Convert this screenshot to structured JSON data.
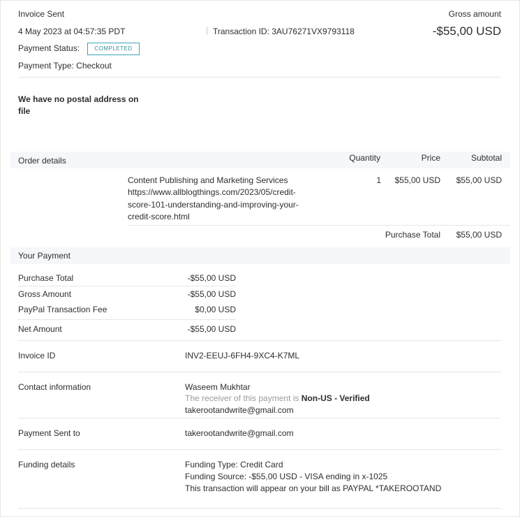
{
  "header": {
    "title": "Invoice Sent",
    "datetime": "4 May 2023 at 04:57:35 PDT",
    "transaction_id": "Transaction ID: 3AU76271VX9793118",
    "gross_label": "Gross amount",
    "gross_value": "-$55,00 USD",
    "status_label": "Payment Status:",
    "status_badge": "COMPLETED",
    "payment_type": "Payment Type: Checkout"
  },
  "address": {
    "line1": "We have no postal address on",
    "line2": "file"
  },
  "order": {
    "header": {
      "title": "Order details",
      "quantity": "Quantity",
      "price": "Price",
      "subtotal": "Subtotal"
    },
    "item": {
      "line1": "Content Publishing and Marketing Services",
      "line2": "https://www.allblogthings.com/2023/05/credit-",
      "line3": "score-101-understanding-and-improving-your-",
      "line4": "credit-score.html",
      "quantity": "1",
      "price": "$55,00 USD",
      "subtotal": "$55,00 USD"
    },
    "purchase_total_label": "Purchase Total",
    "purchase_total_value": "$55,00 USD"
  },
  "payment": {
    "title": "Your Payment",
    "rows": [
      {
        "label": "Purchase Total",
        "value": "-$55,00 USD"
      },
      {
        "label": "Gross Amount",
        "value": "-$55,00 USD"
      },
      {
        "label": "PayPal Transaction Fee",
        "value": "$0,00 USD"
      },
      {
        "label": "Net Amount",
        "value": "-$55,00 USD"
      }
    ]
  },
  "invoice": {
    "label": "Invoice ID",
    "value": "INV2-EEUJ-6FH4-9XC4-K7ML"
  },
  "contact": {
    "label": "Contact information",
    "name": "Waseem Mukhtar",
    "receiver_text": "The receiver of this payment is",
    "receiver_status": "Non-US - Verified",
    "email": "takerootandwrite@gmail.com"
  },
  "sent_to": {
    "label": "Payment Sent to",
    "value": "takerootandwrite@gmail.com"
  },
  "funding": {
    "label": "Funding details",
    "line1": "Funding Type: Credit Card",
    "line2": "Funding Source: -$55,00 USD - VISA ending in x-1025",
    "line3": "This transaction will appear on your bill as PAYPAL *TAKEROOTAND"
  }
}
